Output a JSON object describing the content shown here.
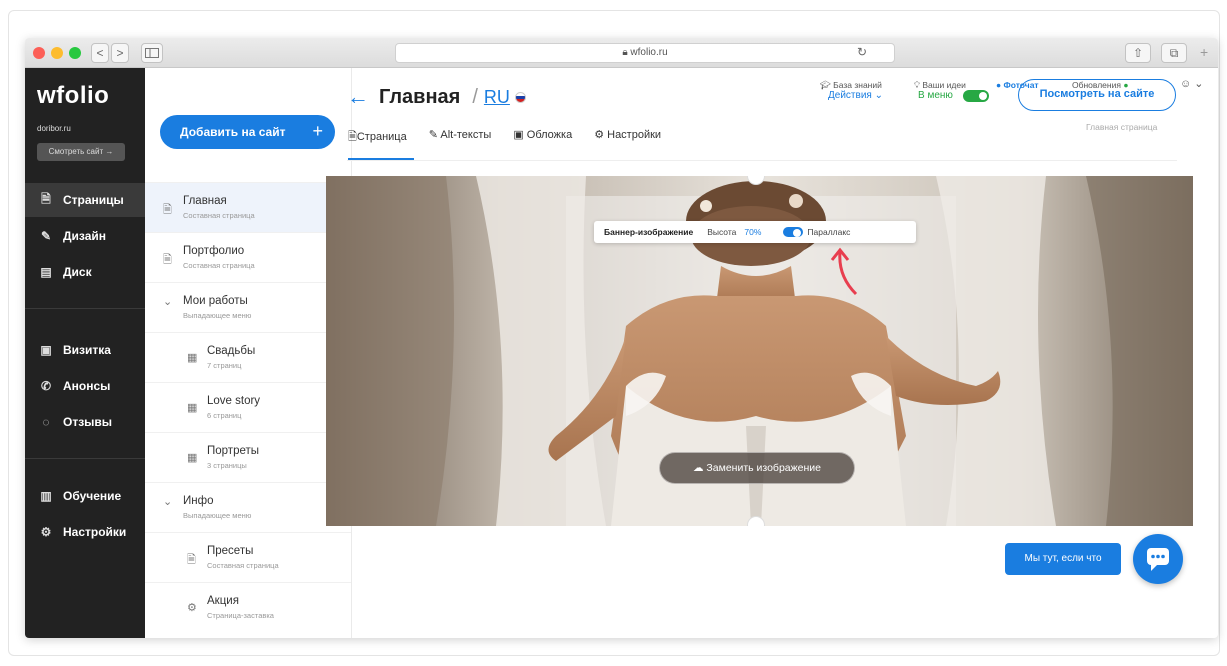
{
  "browser": {
    "url": "wfolio.ru",
    "nav_back": "<",
    "nav_forward": ">",
    "new_tab": "+"
  },
  "brand": {
    "logo": "wfolio",
    "site_name": "doribor.ru",
    "view_site": "Смотреть сайт →"
  },
  "main_nav": [
    {
      "label": "Страницы",
      "icon": "page-icon",
      "glyph": "🗎"
    },
    {
      "label": "Дизайн",
      "icon": "brush-icon",
      "glyph": "✎"
    },
    {
      "label": "Диск",
      "icon": "disk-icon",
      "glyph": "▤"
    },
    {
      "label": "Визитка",
      "icon": "card-icon",
      "glyph": "▣"
    },
    {
      "label": "Анонсы",
      "icon": "megaphone-icon",
      "glyph": "✆"
    },
    {
      "label": "Отзывы",
      "icon": "reviews-icon",
      "glyph": "◌"
    },
    {
      "label": "Обучение",
      "icon": "book-icon",
      "glyph": "▥"
    },
    {
      "label": "Настройки",
      "icon": "gear-icon",
      "glyph": "⚙"
    }
  ],
  "add_button": {
    "label": "Добавить на сайт",
    "plus": "+"
  },
  "pages": [
    {
      "title": "Главная",
      "subtitle": "Составная страница",
      "icon": "page-icon",
      "glyph": "🗎",
      "right": "⌂"
    },
    {
      "title": "Портфолио",
      "subtitle": "Составная страница",
      "icon": "page-icon",
      "glyph": "🗎",
      "right": "⊘"
    },
    {
      "title": "Мои работы",
      "subtitle": "Выпадающее меню",
      "icon": "chevron-down-icon",
      "glyph": "⌄",
      "right": "⊘"
    },
    {
      "title": "Свадьбы",
      "subtitle": "7 страниц",
      "icon": "grid-icon",
      "glyph": "▦",
      "right": ""
    },
    {
      "title": "Love story",
      "subtitle": "6 страниц",
      "icon": "grid-icon",
      "glyph": "▦",
      "right": ""
    },
    {
      "title": "Портреты",
      "subtitle": "3 страницы",
      "icon": "grid-icon",
      "glyph": "▦",
      "right": ""
    },
    {
      "title": "Инфо",
      "subtitle": "Выпадающее меню",
      "icon": "chevron-down-icon",
      "glyph": "⌄",
      "right": "⊘"
    },
    {
      "title": "Пресеты",
      "subtitle": "Составная страница",
      "icon": "page-icon",
      "glyph": "🗎",
      "right": ""
    },
    {
      "title": "Акция",
      "subtitle": "Страница-заставка",
      "icon": "gear-icon",
      "glyph": "⚙",
      "right": ""
    }
  ],
  "topbar": {
    "knowledge": "База знаний",
    "ideas": "Ваши идеи",
    "photochat": "Фоточат",
    "updates": "Обновления",
    "account_glyph": "☺ ⌄"
  },
  "header": {
    "back_glyph": "←",
    "title": "Главная",
    "slash": "/",
    "lang": "RU",
    "actions": "Действия ⌄",
    "in_menu": "В меню",
    "view_on_site": "Посмотреть на сайте",
    "page_subtitle": "Главная страница"
  },
  "tabs": [
    "Страница",
    "Alt-тексты",
    "Обложка",
    "Настройки"
  ],
  "banner": {
    "label": "Баннер-изображение",
    "height_label": "Высота",
    "height_value": "70%",
    "parallax": "Параллакс",
    "replace": "Заменить изображение"
  },
  "chat": {
    "pill": "Мы тут, если что"
  },
  "colors": {
    "accent": "#1a7de0",
    "green": "#27a844",
    "sidebar": "#222222"
  }
}
